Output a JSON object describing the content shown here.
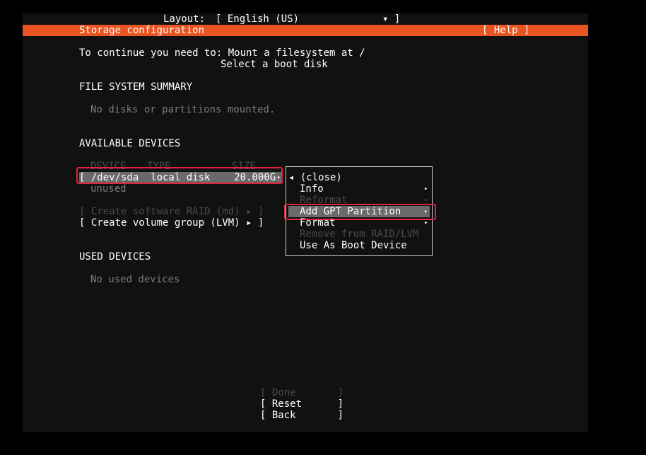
{
  "header": {
    "layout_label": "Layout:",
    "layout_value": "[ English (US)              ▾ ]",
    "title": "Storage configuration",
    "help": "[ Help ]"
  },
  "intro": {
    "line1": "To continue you need to: Mount a filesystem at /",
    "line2": "Select a boot disk"
  },
  "fs_summary": {
    "heading": "FILE SYSTEM SUMMARY",
    "empty": "No disks or partitions mounted."
  },
  "available": {
    "heading": "AVAILABLE DEVICES",
    "columns": [
      "DEVICE",
      "TYPE",
      "SIZE"
    ],
    "device_row": "[ /dev/sda  local disk    20.000G",
    "device_arrow": "▸",
    "device_sub": "unused",
    "create_raid": "[ Create software RAID (md) ▸ ]",
    "create_lvm": "[ Create volume group (LVM) ▸ ]"
  },
  "context_menu": {
    "close": "◂ (close)",
    "info": "Info",
    "reformat": "Reformat",
    "add_gpt": "Add GPT Partition",
    "format": "Format",
    "remove_raid": "Remove from RAID/LVM",
    "boot": "Use As Boot Device",
    "arrow": "▸"
  },
  "used": {
    "heading": "USED DEVICES",
    "empty": "No used devices"
  },
  "buttons": {
    "done": "[ Done       ]",
    "reset": "[ Reset      ]",
    "back": "[ Back       ]"
  },
  "colors": {
    "accent": "#e95420",
    "highlight_box": "#e0243c",
    "selection": "#6a6a6a"
  }
}
